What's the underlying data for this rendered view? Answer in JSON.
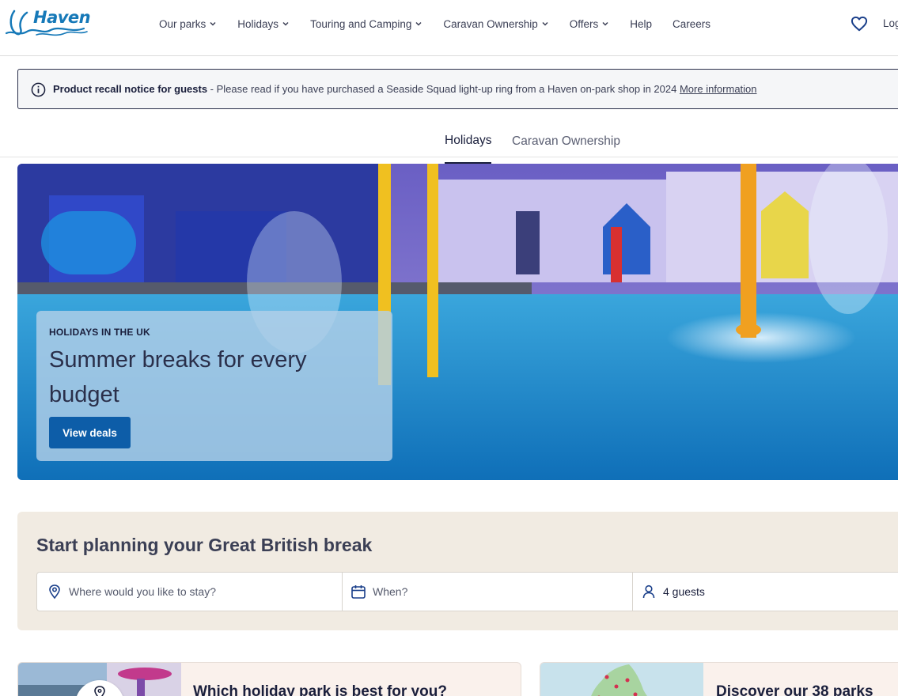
{
  "brand": {
    "name": "Haven"
  },
  "nav": {
    "items": [
      {
        "label": "Our parks",
        "has_dropdown": true
      },
      {
        "label": "Holidays",
        "has_dropdown": true
      },
      {
        "label": "Touring and Camping",
        "has_dropdown": true
      },
      {
        "label": "Caravan Ownership",
        "has_dropdown": true
      },
      {
        "label": "Offers",
        "has_dropdown": true
      },
      {
        "label": "Help",
        "has_dropdown": false
      },
      {
        "label": "Careers",
        "has_dropdown": false
      }
    ],
    "favourites_icon": "heart-icon",
    "login_label": "Log"
  },
  "notice": {
    "title": "Product recall notice for guests",
    "message": " - Please read if you have purchased a Seaside Squad light-up ring from a Haven on-park shop in 2024 ",
    "link_label": "More information",
    "icon": "info-icon"
  },
  "tabs": [
    {
      "label": "Holidays",
      "active": true
    },
    {
      "label": "Caravan Ownership",
      "active": false
    }
  ],
  "hero": {
    "eyebrow": "HOLIDAYS IN THE UK",
    "title": "Summer breaks for every budget",
    "cta_label": "View deals"
  },
  "planner": {
    "title": "Start planning your Great British break",
    "where_placeholder": "Where would you like to stay?",
    "when_placeholder": "When?",
    "guests_value": "4 guests"
  },
  "cards": [
    {
      "title": "Which holiday park is best for you?"
    },
    {
      "title": "Discover our 38 parks"
    }
  ],
  "colors": {
    "primary_navy": "#1a1f3c",
    "brand_blue": "#1679b8",
    "button_blue": "#0d5da8",
    "planner_bg": "#f1ebe2",
    "card_bg": "#faf1ec"
  }
}
